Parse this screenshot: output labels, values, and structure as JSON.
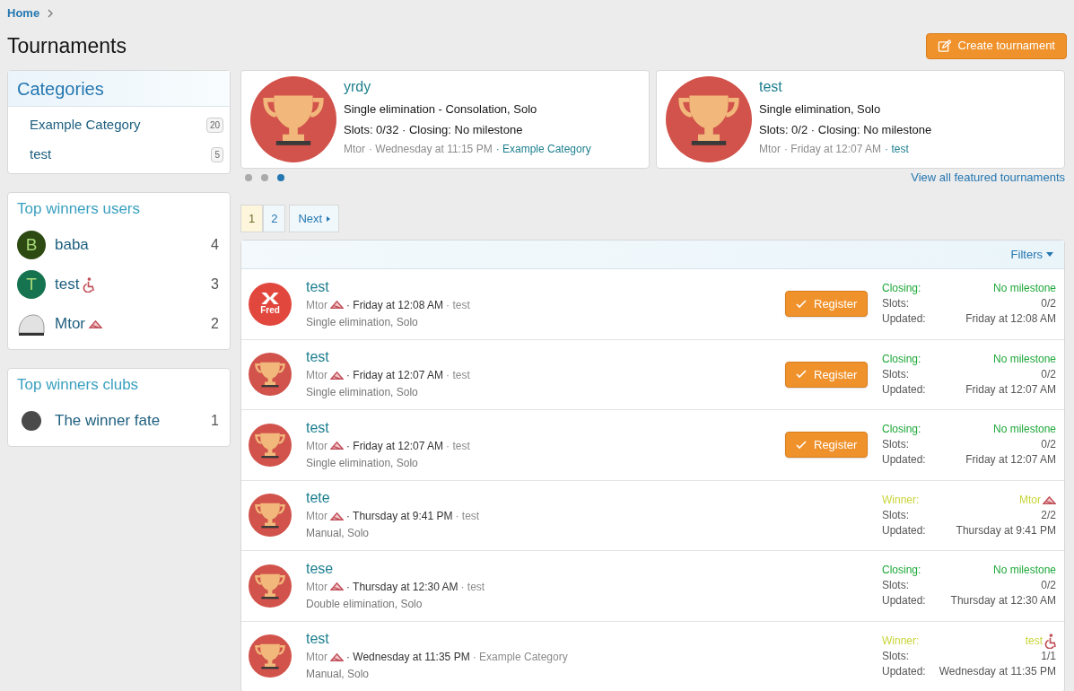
{
  "breadcrumb": [
    "Home"
  ],
  "title": "Tournaments",
  "create_button": "Create tournament",
  "categories": {
    "title": "Categories",
    "items": [
      {
        "label": "Example Category",
        "count": "20"
      },
      {
        "label": "test",
        "count": "5"
      }
    ]
  },
  "top_users": {
    "title": "Top winners users",
    "items": [
      {
        "avatar": {
          "kind": "letter",
          "letter": "B",
          "color": "#2c4a12"
        },
        "name": "baba",
        "count": "4"
      },
      {
        "avatar": {
          "kind": "letter",
          "letter": "T",
          "color": "#16734f"
        },
        "name": "test",
        "badge": {
          "kind": "wheelchair"
        },
        "count": "3"
      },
      {
        "avatar": {
          "kind": "photo"
        },
        "name": "Mtor",
        "badge": {
          "kind": "rank"
        },
        "count": "2"
      }
    ]
  },
  "top_clubs": {
    "title": "Top winners clubs",
    "items": [
      {
        "name": "The winner fate",
        "count": "1"
      }
    ]
  },
  "featured": [
    {
      "title": "yrdy",
      "format": "Single elimination - Consolation, Solo",
      "info": "Slots: 0/32 · Closing: No milestone",
      "author": "Mtor",
      "time": "· Wednesday at 11:15 PM",
      "category": "· Example Category"
    },
    {
      "title": "test",
      "format": "Single elimination, Solo",
      "info": "Slots: 0/2 · Closing: No milestone",
      "author": "Mtor",
      "time": "· Friday at 12:07 AM",
      "category": "· test"
    }
  ],
  "carousel_dots": [
    {
      "selected": false
    },
    {
      "selected": false
    },
    {
      "selected": true
    }
  ],
  "view_all_link": "View all featured tournaments",
  "pagination": {
    "pages": [
      {
        "label": "1",
        "selected": true
      },
      {
        "label": "2",
        "selected": false
      }
    ],
    "next": "Next"
  },
  "filters": "Filters",
  "tournaments": [
    {
      "avatar": {
        "kind": "fred",
        "text": "Fred"
      },
      "title": "test",
      "author": "Mtor",
      "time": "· Friday at 12:08 AM",
      "category": "· test",
      "format": "Single elimination, Solo",
      "register": "Register",
      "status": {
        "kind": "closing",
        "label": "Closing:",
        "value": "No milestone"
      },
      "slots_label": "Slots:",
      "slots": "0/2",
      "updated_label": "Updated:",
      "updated": "Friday at 12:08 AM"
    },
    {
      "avatar": {
        "kind": "trophy"
      },
      "title": "test",
      "author": "Mtor",
      "time": "· Friday at 12:07 AM",
      "category": "· test",
      "format": "Single elimination, Solo",
      "register": "Register",
      "status": {
        "kind": "closing",
        "label": "Closing:",
        "value": "No milestone"
      },
      "slots_label": "Slots:",
      "slots": "0/2",
      "updated_label": "Updated:",
      "updated": "Friday at 12:07 AM"
    },
    {
      "avatar": {
        "kind": "trophy"
      },
      "title": "test",
      "author": "Mtor",
      "time": "· Friday at 12:07 AM",
      "category": "· test",
      "format": "Single elimination, Solo",
      "register": "Register",
      "status": {
        "kind": "closing",
        "label": "Closing:",
        "value": "No milestone"
      },
      "slots_label": "Slots:",
      "slots": "0/2",
      "updated_label": "Updated:",
      "updated": "Friday at 12:07 AM"
    },
    {
      "avatar": {
        "kind": "trophy"
      },
      "title": "tete",
      "author": "Mtor",
      "time": "· Thursday at 9:41 PM",
      "category": "· test",
      "format": "Manual, Solo",
      "status": {
        "kind": "winner",
        "label": "Winner:",
        "value": "Mtor",
        "badge": {
          "kind": "rank"
        }
      },
      "slots_label": "Slots:",
      "slots": "2/2",
      "updated_label": "Updated:",
      "updated": "Thursday at 9:41 PM"
    },
    {
      "avatar": {
        "kind": "trophy"
      },
      "title": "tese",
      "author": "Mtor",
      "time": "· Thursday at 12:30 AM",
      "category": "· test",
      "format": "Double elimination, Solo",
      "status": {
        "kind": "closing",
        "label": "Closing:",
        "value": "No milestone"
      },
      "slots_label": "Slots:",
      "slots": "0/2",
      "updated_label": "Updated:",
      "updated": "Thursday at 12:30 AM"
    },
    {
      "avatar": {
        "kind": "trophy"
      },
      "title": "test",
      "author": "Mtor",
      "time": "· Wednesday at 11:35 PM",
      "category": "· Example Category",
      "format": "Manual, Solo",
      "status": {
        "kind": "winner",
        "label": "Winner:",
        "value": "test",
        "badge": {
          "kind": "wheelchair"
        }
      },
      "slots_label": "Slots:",
      "slots": "1/1",
      "updated_label": "Updated:",
      "updated": "Wednesday at 11:35 PM"
    }
  ]
}
